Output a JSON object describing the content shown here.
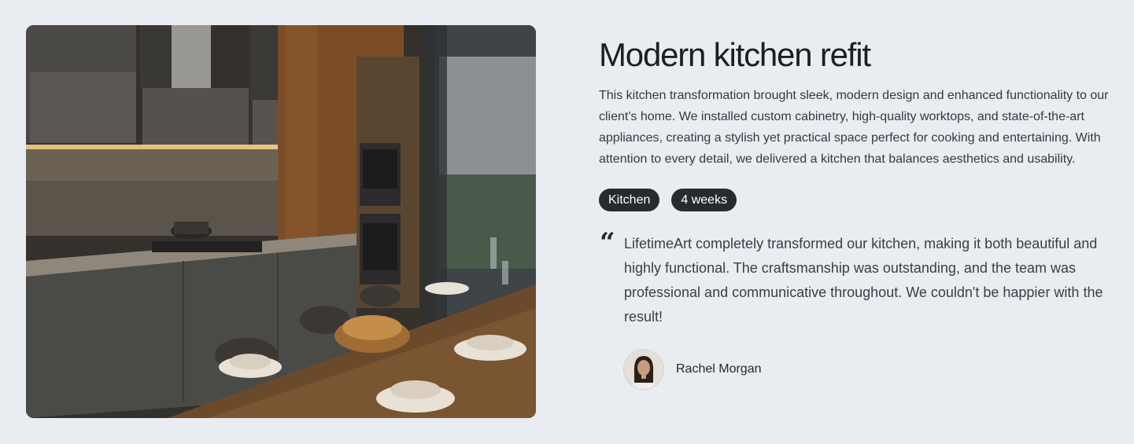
{
  "project": {
    "image_alt": "Modern kitchen interior with dark cabinets and wooden dining table",
    "title": "Modern kitchen refit",
    "description": "This kitchen transformation brought sleek, modern design and enhanced  functionality to our client's home. We installed custom cabinetry, high-quality worktops, and state-of-the-art appliances, creating a stylish yet practical space perfect for cooking and entertaining. With attention to every detail, we delivered a kitchen that balances aesthetics and usability.",
    "tags": [
      "Kitchen",
      "4 weeks"
    ]
  },
  "testimonial": {
    "quote_mark": "“",
    "text": "LifetimeArt completely transformed our kitchen, making it both beautiful and highly functional. The craftsmanship was outstanding, and the team was professional and communicative throughout. We couldn't be happier with the result!",
    "author_name": "Rachel Morgan"
  },
  "colors": {
    "background": "#e9edf2",
    "tag_background": "#272a2f",
    "tag_text": "#ffffff"
  }
}
